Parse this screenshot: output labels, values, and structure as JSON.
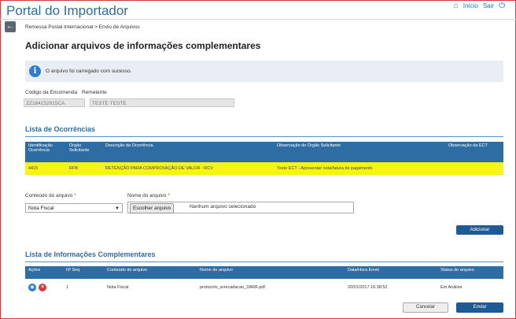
{
  "header": {
    "title": "Portal do Importador",
    "links": {
      "home": "Início",
      "logout": "Sair"
    }
  },
  "breadcrumb": "Remessa Postal Internacional > Envio de Arquivos",
  "page_title": "Adicionar arquivos de informações complementares",
  "alert": {
    "message": "O arquivo foi carregado com sucesso."
  },
  "shipment": {
    "code_label": "Código da Encomenda",
    "code_value": "ZZ184152915CA",
    "sender_label": "Remetente",
    "sender_value": "TESTE TESTE"
  },
  "occurrences": {
    "title": "Lista de Ocorrências",
    "headers": [
      "Identificação Ocorrência",
      "Órgão Solicitante",
      "Descrição da Ocorrência",
      "Observação do Órgão Solicitante",
      "Observação da ECT"
    ],
    "rows": [
      {
        "id": "4415",
        "org": "RFB",
        "description": "RETENÇÃO PARA COMPROVAÇÃO DE VALOR - RCV",
        "org_note": "Teste ECT - Apresentar nota/fatura de pagamento",
        "ect_note": ""
      }
    ]
  },
  "upload": {
    "content_label": "Conteúdo do arquivo",
    "content_value": "Nota Fiscal",
    "file_label": "Nome do arquivo",
    "choose_label": "Escolher arquivo",
    "no_file_text": "Nenhum arquivo selecionado",
    "add_label": "Adicionar"
  },
  "complementary": {
    "title": "Lista de Informações Complementares",
    "headers": [
      "Ações",
      "Nº Seq",
      "Conteúdo do arquivo",
      "Nome do arquivo",
      "Data/Hora Envio",
      "Status do arquivo"
    ],
    "rows": [
      {
        "seq": "1",
        "content": "Nota Fiscal",
        "filename": "protocolo_arrecadacao_DARF.pdf",
        "datetime": "20/01/2017 16:38:52",
        "status": "Em Análise"
      }
    ]
  },
  "footer": {
    "cancel_label": "Cancelar",
    "send_label": "Enviar"
  },
  "colors": {
    "primary": "#2e6da4",
    "highlight_row": "#f7f317",
    "alert_bg": "#e8eef3",
    "delete": "#d23a3a"
  }
}
